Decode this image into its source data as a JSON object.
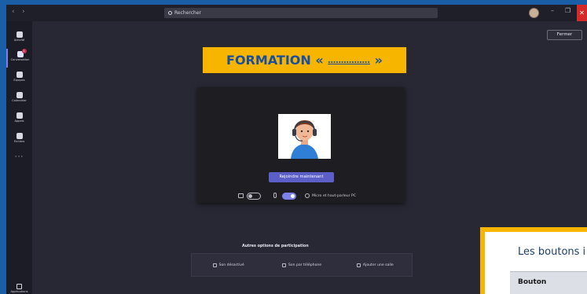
{
  "titlebar": {
    "back": "‹",
    "forward": "›",
    "search_placeholder": "Rechercher",
    "minimize": "–",
    "restore": "❐",
    "close": "✕"
  },
  "rail": {
    "items": [
      {
        "label": "Activité",
        "icon": "bell-icon"
      },
      {
        "label": "Conversation",
        "icon": "chat-icon",
        "badge": "1"
      },
      {
        "label": "Équipes",
        "icon": "teams-icon"
      },
      {
        "label": "Calendrier",
        "icon": "calendar-icon"
      },
      {
        "label": "Appels",
        "icon": "phone-icon"
      },
      {
        "label": "Fichiers",
        "icon": "file-icon"
      }
    ],
    "more": "···",
    "apps_label": "Applications"
  },
  "fermer_label": "Fermer",
  "banner": {
    "prefix": "FORMATION « ",
    "blank": "……",
    "blank_underlined": "……….",
    "suffix": " »"
  },
  "prejoin": {
    "join_label": "Rejoindre maintenant",
    "device_text": "Micro et haut-parleur PC"
  },
  "other_options": {
    "title": "Autres options de participation",
    "items": [
      {
        "label": "Son désactivé",
        "icon": "speaker-off-icon"
      },
      {
        "label": "Son par téléphone",
        "icon": "phone-icon"
      },
      {
        "label": "Ajouter une salle",
        "icon": "cast-icon"
      }
    ]
  },
  "overlay": {
    "title": "Les boutons i",
    "table_header": "Bouton"
  },
  "colors": {
    "accent": "#5b5fc7",
    "banner": "#f7b500",
    "banner_text": "#1a4fa0",
    "close_red": "#d42a2a"
  }
}
